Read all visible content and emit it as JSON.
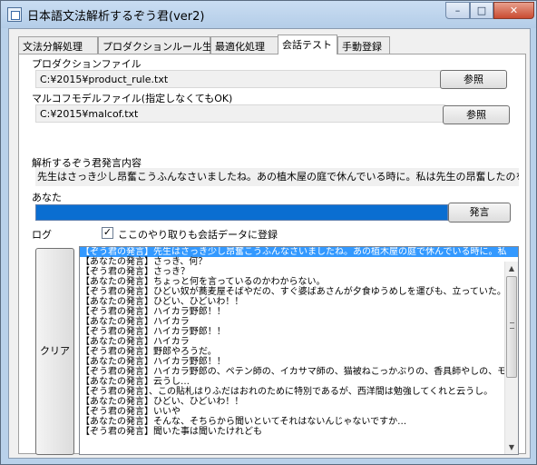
{
  "window": {
    "title": "日本語文法解析するぞう君(ver2)",
    "min_glyph": "–",
    "max_glyph": "□",
    "close_glyph": "✕"
  },
  "tabs": [
    {
      "label": "文法分解処理"
    },
    {
      "label": "プロダクションルール生成"
    },
    {
      "label": "最適化処理"
    },
    {
      "label": "会話テスト"
    },
    {
      "label": "手動登録"
    }
  ],
  "active_tab": "会話テスト",
  "form": {
    "production_label": "プロダクションファイル",
    "production_value": "C:¥2015¥product_rule.txt",
    "ref_button_1": "参照",
    "markov_label": "マルコフモデルファイル(指定しなくてもOK)",
    "markov_value": "C:¥2015¥malcof.txt",
    "ref_button_2": "参照",
    "zoukun_said_label": "解析するぞう君発言内容",
    "zoukun_said_value": "先生はさっき少し昂奮こうふんなさいましたね。あの植木屋の庭で休んでいる時に。私は先生の昂奮したのを滅多",
    "you_label": "あなた",
    "you_value": "",
    "speak_button": "発言",
    "log_label": "ログ",
    "register_checkbox_label": "ここのやり取りも会話データに登録",
    "register_checked": true,
    "clear_button": "クリア"
  },
  "log_lines": [
    "【ぞう君の発言】先生はさっき少し昂奮こうふんなさいましたね。あの植木屋の庭で休んでいる時に。私",
    "【あなたの発言】さっき、何？",
    "【ぞう君の発言】さっき？",
    "【あなたの発言】ちょっと何を言っているのかわからない。",
    "【ぞう君の発言】ひどい奴が蕎麦屋そばやだの、すぐ婆ばあさんが夕食ゆうめしを運びも、立っていた。",
    "【あなたの発言】ひどい、ひどいわ！！",
    "【ぞう君の発言】ハイカラ野郎！！",
    "【あなたの発言】ハイカラ",
    "【ぞう君の発言】ハイカラ野郎！！",
    "【あなたの発言】ハイカラ",
    "【ぞう君の発言】野郎やろうだ。",
    "【あなたの発言】ハイカラ野郎！！",
    "【ぞう君の発言】ハイカラ野郎の、ペテン師の、イカサマ師の、猫被ねこっかぶりの、香具師やしの、モモ",
    "【あなたの発言】云うし…",
    "【ぞう君の発言】、この貼札はりふだはおれのために特別であるが、西洋間は勉強してくれと云うし。",
    "【あなたの発言】ひどい、ひどいわ！！",
    "【ぞう君の発言】いいや",
    "【あなたの発言】そんな、そちらから聞いといてそれはないんじゃないですか…",
    "【ぞう君の発言】聞いた事は聞いたけれども"
  ],
  "colors": {
    "frame": "#b9d1ea",
    "selection": "#3399ff",
    "input_focus": "#0a6ed1"
  },
  "icons": {
    "app": "app-icon",
    "checkbox": "checkbox-checked-icon",
    "scroll_up": "scroll-up-arrow-icon",
    "scroll_down": "scroll-down-arrow-icon"
  }
}
